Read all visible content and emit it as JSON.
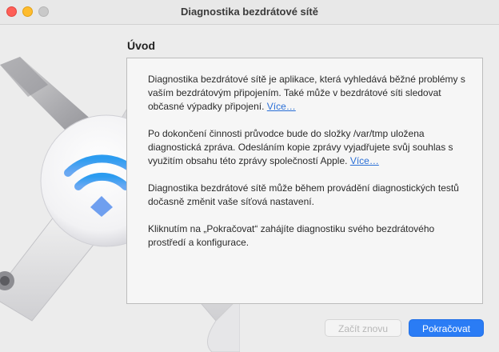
{
  "window": {
    "title": "Diagnostika bezdrátové sítě"
  },
  "section": {
    "title": "Úvod"
  },
  "content": {
    "p1_text": "Diagnostika bezdrátové sítě je aplikace, která vyhledává běžné problémy s vaším bezdrátovým připojením. Také může v bezdrátové síti sledovat občasné výpadky připojení. ",
    "p1_link": "Více…",
    "p2_text": "Po dokončení činnosti průvodce bude do složky /var/tmp uložena diagnostická zpráva. Odesláním kopie zprávy vyjadřujete svůj souhlas s využitím obsahu této zprávy společností Apple. ",
    "p2_link": "Více…",
    "p3_text": "Diagnostika bezdrátové sítě může během provádění diagnostických testů dočasně změnit vaše síťová nastavení.",
    "p4_text": "Kliknutím na „Pokračovat“ zahájíte diagnostiku svého bezdrátového prostředí a konfigurace."
  },
  "buttons": {
    "restart_label": "Začít znovu",
    "continue_label": "Pokračovat"
  },
  "colors": {
    "accent": "#2a7cf5",
    "link": "#2a6fd6"
  },
  "icons": {
    "illustration": "wifi-wrench-icon"
  }
}
